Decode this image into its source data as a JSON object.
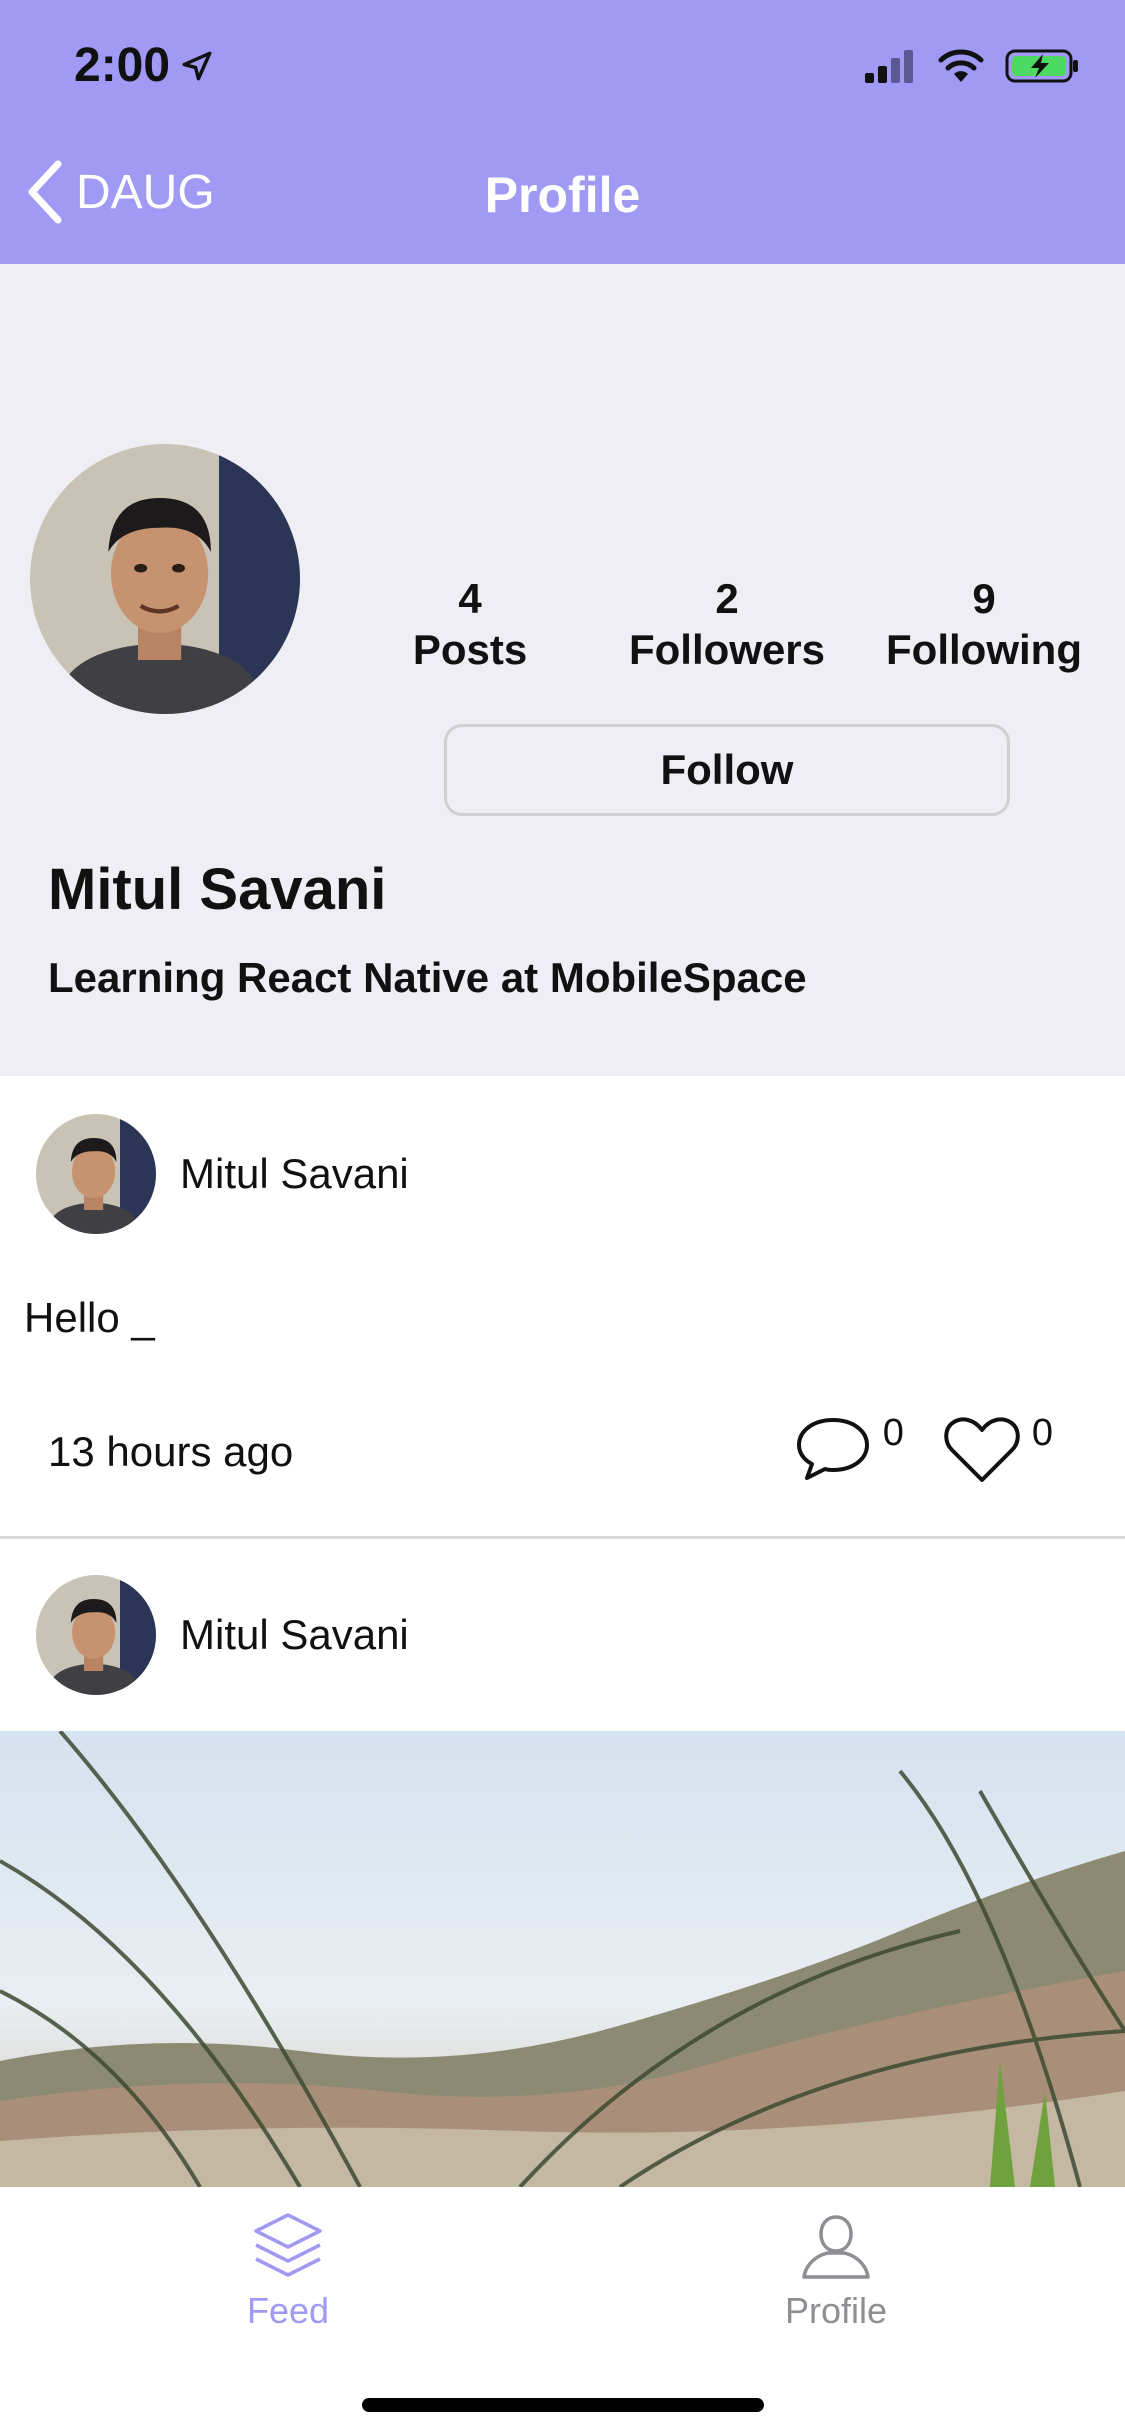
{
  "status_bar": {
    "time": "2:00",
    "icons": [
      "location-arrow-icon",
      "cellular-signal-icon",
      "wifi-icon",
      "battery-charging-icon"
    ]
  },
  "nav": {
    "back_label": "DAUG",
    "title": "Profile"
  },
  "profile": {
    "name": "Mitul Savani",
    "bio": "Learning React Native at MobileSpace",
    "stats": [
      {
        "count": "4",
        "label": "Posts"
      },
      {
        "count": "2",
        "label": "Followers"
      },
      {
        "count": "9",
        "label": "Following"
      }
    ],
    "follow_label": "Follow"
  },
  "posts": [
    {
      "author": "Mitul Savani",
      "text": "Hello _",
      "time": "13 hours ago",
      "comments": "0",
      "likes": "0"
    },
    {
      "author": "Mitul Savani"
    }
  ],
  "tabbar": {
    "tabs": [
      {
        "label": "Feed",
        "icon": "layers-icon",
        "active": true
      },
      {
        "label": "Profile",
        "icon": "user-icon",
        "active": false
      }
    ]
  },
  "colors": {
    "accent": "#a09af5",
    "profile_bg": "#efeef4",
    "inactive_tab": "#8e8e93"
  }
}
